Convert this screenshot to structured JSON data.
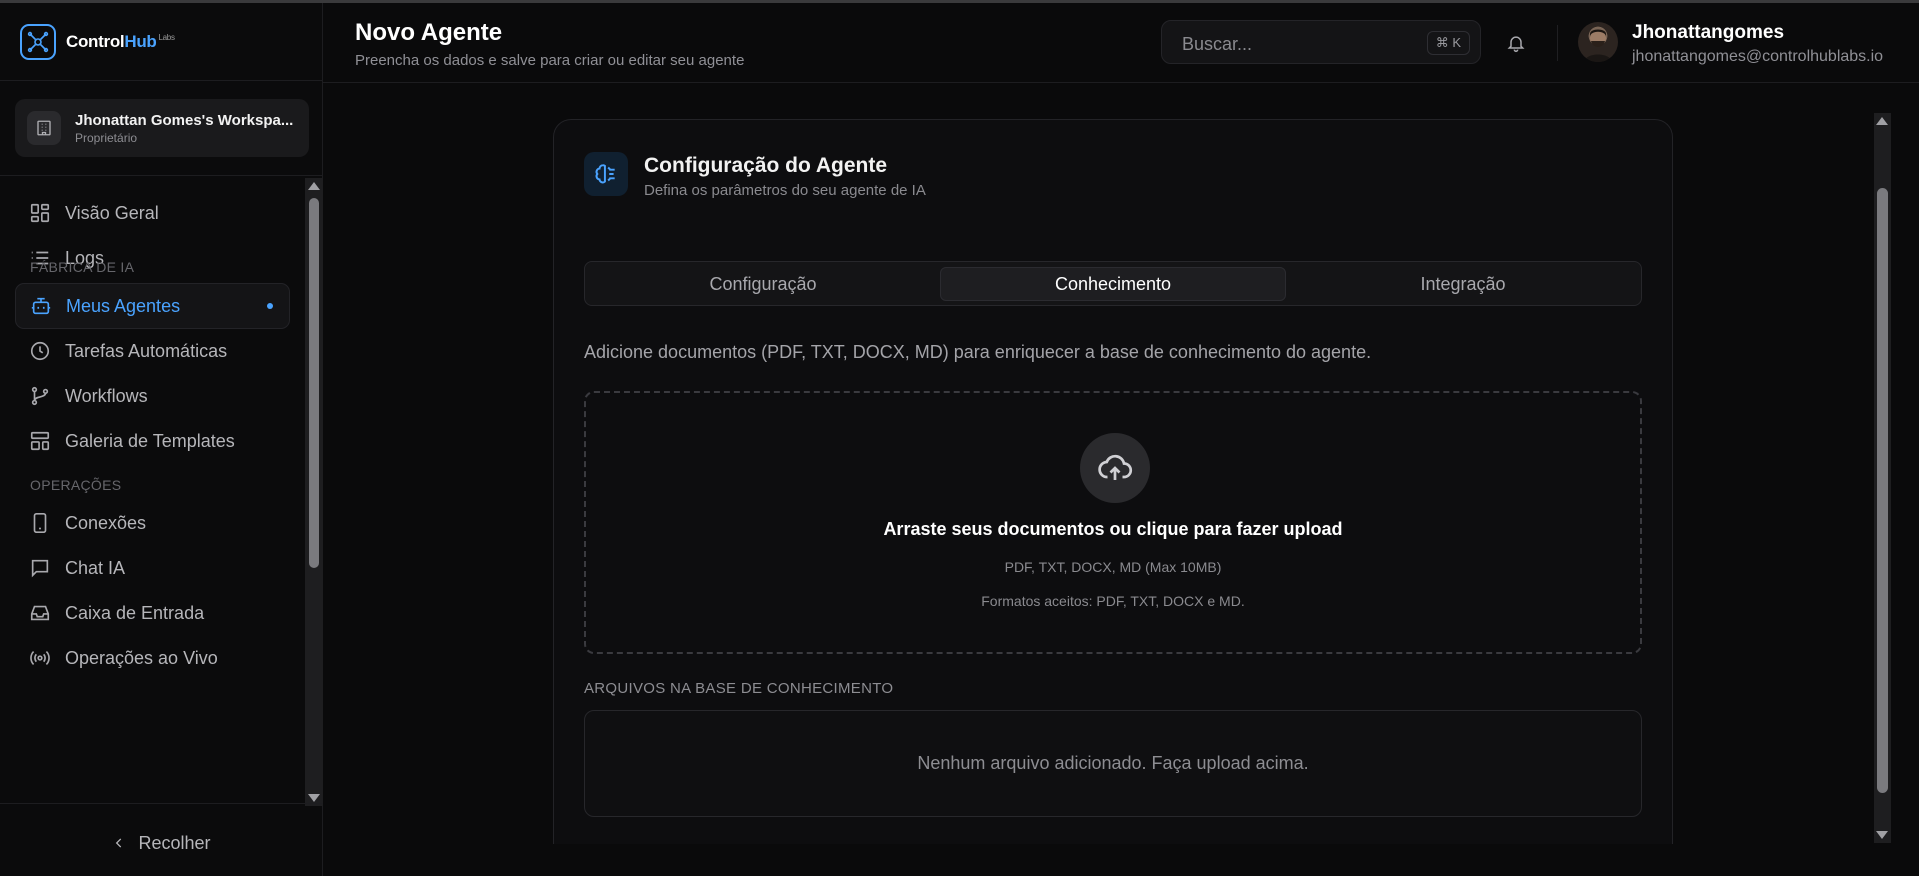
{
  "brand": {
    "name_part1": "Control",
    "name_part2": "Hub",
    "superscript": "Labs",
    "accent_color": "#4aa3ff"
  },
  "workspace": {
    "name": "Jhonattan Gomes's Workspa...",
    "role": "Proprietário"
  },
  "sidebar": {
    "items": [
      {
        "label": "Visão Geral",
        "icon": "dashboard-icon"
      },
      {
        "label": "Logs",
        "icon": "list-icon"
      },
      {
        "label": "Meus Agentes",
        "icon": "bot-icon",
        "active": true
      },
      {
        "label": "Tarefas Automáticas",
        "icon": "clock-icon"
      },
      {
        "label": "Workflows",
        "icon": "git-branch-icon"
      },
      {
        "label": "Galeria de Templates",
        "icon": "template-icon"
      },
      {
        "label": "Conexões",
        "icon": "smartphone-icon"
      },
      {
        "label": "Chat IA",
        "icon": "chat-icon"
      },
      {
        "label": "Caixa de Entrada",
        "icon": "inbox-icon"
      },
      {
        "label": "Operações ao Vivo",
        "icon": "broadcast-icon"
      }
    ],
    "sections": {
      "ai_factory": "FÁBRICA DE IA",
      "operations": "OPERAÇÕES"
    },
    "collapse_label": "Recolher"
  },
  "header": {
    "title": "Novo Agente",
    "subtitle": "Preencha os dados e salve para criar ou editar seu agente",
    "search_placeholder": "Buscar...",
    "search_shortcut": "⌘ K",
    "user_name": "Jhonattangomes",
    "user_email": "jhonattangomes@controlhublabs.io"
  },
  "main": {
    "card_title": "Configuração do Agente",
    "card_subtitle": "Defina os parâmetros do seu agente de IA",
    "tabs": [
      {
        "label": "Configuração"
      },
      {
        "label": "Conhecimento",
        "active": true
      },
      {
        "label": "Integração"
      }
    ],
    "description": "Adicione documentos (PDF, TXT, DOCX, MD) para enriquecer a base de conhecimento do agente.",
    "dropzone": {
      "title": "Arraste seus documentos ou clique para fazer upload",
      "formats": "PDF, TXT, DOCX, MD (Max 10MB)",
      "accepted": "Formatos aceitos: PDF, TXT, DOCX e MD."
    },
    "files_label": "ARQUIVOS NA BASE DE CONHECIMENTO",
    "files_empty": "Nenhum arquivo adicionado. Faça upload acima."
  }
}
